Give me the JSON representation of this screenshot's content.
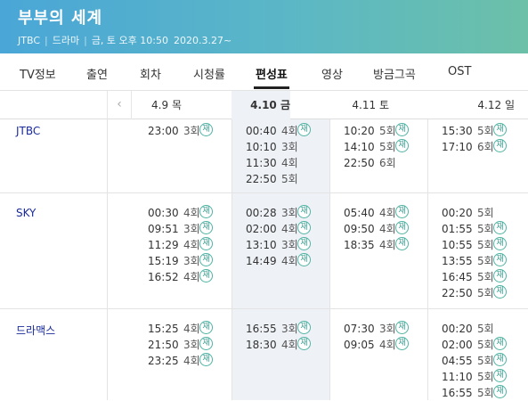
{
  "program": {
    "title": "부부의 세계",
    "channel": "JTBC",
    "genre": "드라마",
    "airtime": "금, 토 오후 10:50",
    "start_date": "2020.3.27~"
  },
  "tabs": [
    "TV정보",
    "출연",
    "회차",
    "시청률",
    "편성표",
    "영상",
    "방금그곡",
    "OST"
  ],
  "active_tab": "편성표",
  "prev_icon": "‹",
  "dates": [
    "4.9 목",
    "4.10 금",
    "4.11 토",
    "4.12 일"
  ],
  "selected_date": "4.10 금",
  "rerun_mark": "재",
  "schedule": [
    {
      "channel": "JTBC",
      "days": [
        [
          {
            "time": "23:00",
            "ep": "3회",
            "re": true
          }
        ],
        [
          {
            "time": "00:40",
            "ep": "4회",
            "re": true
          },
          {
            "time": "10:10",
            "ep": "3회",
            "re": false
          },
          {
            "time": "11:30",
            "ep": "4회",
            "re": false
          },
          {
            "time": "22:50",
            "ep": "5회",
            "re": false
          }
        ],
        [
          {
            "time": "10:20",
            "ep": "5회",
            "re": true
          },
          {
            "time": "14:10",
            "ep": "5회",
            "re": true
          },
          {
            "time": "22:50",
            "ep": "6회",
            "re": false
          }
        ],
        [
          {
            "time": "15:30",
            "ep": "5회",
            "re": true
          },
          {
            "time": "17:10",
            "ep": "6회",
            "re": true
          }
        ]
      ]
    },
    {
      "channel": "SKY",
      "days": [
        [
          {
            "time": "00:30",
            "ep": "4회",
            "re": true
          },
          {
            "time": "09:51",
            "ep": "3회",
            "re": true
          },
          {
            "time": "11:29",
            "ep": "4회",
            "re": true
          },
          {
            "time": "15:19",
            "ep": "3회",
            "re": true
          },
          {
            "time": "16:52",
            "ep": "4회",
            "re": true
          }
        ],
        [
          {
            "time": "00:28",
            "ep": "3회",
            "re": true
          },
          {
            "time": "02:00",
            "ep": "4회",
            "re": true
          },
          {
            "time": "13:10",
            "ep": "3회",
            "re": true
          },
          {
            "time": "14:49",
            "ep": "4회",
            "re": true
          }
        ],
        [
          {
            "time": "05:40",
            "ep": "4회",
            "re": true
          },
          {
            "time": "09:50",
            "ep": "4회",
            "re": true
          },
          {
            "time": "18:35",
            "ep": "4회",
            "re": true
          }
        ],
        [
          {
            "time": "00:20",
            "ep": "5회",
            "re": false
          },
          {
            "time": "01:55",
            "ep": "5회",
            "re": true
          },
          {
            "time": "10:55",
            "ep": "5회",
            "re": true
          },
          {
            "time": "13:55",
            "ep": "5회",
            "re": true
          },
          {
            "time": "16:45",
            "ep": "5회",
            "re": true
          },
          {
            "time": "22:50",
            "ep": "5회",
            "re": true
          }
        ]
      ]
    },
    {
      "channel": "드라맥스",
      "days": [
        [
          {
            "time": "15:25",
            "ep": "4회",
            "re": true
          },
          {
            "time": "21:50",
            "ep": "3회",
            "re": true
          },
          {
            "time": "23:25",
            "ep": "4회",
            "re": true
          }
        ],
        [
          {
            "time": "16:55",
            "ep": "3회",
            "re": true
          },
          {
            "time": "18:30",
            "ep": "4회",
            "re": true
          }
        ],
        [
          {
            "time": "07:30",
            "ep": "3회",
            "re": true
          },
          {
            "time": "09:05",
            "ep": "4회",
            "re": true
          }
        ],
        [
          {
            "time": "00:20",
            "ep": "5회",
            "re": false
          },
          {
            "time": "02:00",
            "ep": "5회",
            "re": true
          },
          {
            "time": "04:55",
            "ep": "5회",
            "re": true
          },
          {
            "time": "11:10",
            "ep": "5회",
            "re": true
          },
          {
            "time": "16:55",
            "ep": "5회",
            "re": true
          }
        ]
      ]
    }
  ]
}
